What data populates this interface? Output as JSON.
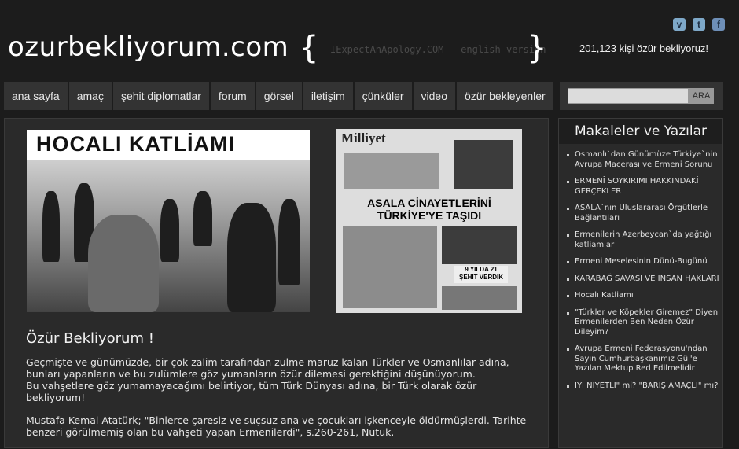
{
  "header": {
    "logo": "ozurbekliyorum.com",
    "brace_open": "{",
    "brace_close": "}",
    "tagline": "IExpectAnApology.COM - english version",
    "social": {
      "vimeo": "v",
      "twitter": "t",
      "facebook": "f"
    },
    "counter_number": "201,123",
    "counter_text": " kişi özür bekliyoruz!"
  },
  "nav": [
    "ana sayfa",
    "amaç",
    "şehit diplomatlar",
    "forum",
    "görsel",
    "iletişim",
    "çünküler",
    "video",
    "özür bekleyenler"
  ],
  "search": {
    "placeholder": "",
    "button": "ARA"
  },
  "main": {
    "photo1_title": "HOCALI KATLİAMI",
    "photo2_masthead": "Milliyet",
    "photo2_headline1": "ASALA CİNAYETLERİNİ",
    "photo2_headline2": "TÜRKİYE'YE TAŞIDI",
    "photo2_box1": "9 YILDA 21",
    "photo2_box2": "ŞEHİT VERDİK",
    "article_title": "Özür Bekliyorum !",
    "paragraph1": "Geçmişte ve günümüzde, bir çok zalim tarafından zulme maruz kalan Türkler ve Osmanlılar adına, bunları yapanların ve bu zulümlere göz yumanların özür dilemesi gerektiğini düşünüyorum.",
    "paragraph1b": "Bu vahşetlere göz yumamayacağımı belirtiyor, tüm Türk Dünyası adına, bir Türk olarak özür bekliyorum!",
    "paragraph2": "Mustafa Kemal Atatürk; \"Binlerce çaresiz ve suçsuz ana ve çocukları işkenceyle öldürmüşlerdi. Tarihte benzeri görülmemiş olan bu vahşeti yapan Ermenilerdi\", s.260-261, Nutuk."
  },
  "sidebar": {
    "title": "Makaleler ve Yazılar",
    "items": [
      "Osmanlı`dan Günümüze Türkiye`nin Avrupa Macerası ve Ermeni Sorunu",
      "ERMENİ SOYKIRIMI HAKKINDAKİ GERÇEKLER",
      "ASALA`nın Uluslararası Örgütlerle Bağlantıları",
      "Ermenilerin Azerbeycan`da yağtığı katliamlar",
      "Ermeni Meselesinin Dünü-Bugünü",
      "KARABAĞ SAVAŞI VE İNSAN HAKLARI",
      "Hocalı Katliamı",
      "\"Türkler ve Köpekler Giremez\" Diyen Ermenilerden Ben Neden Özür Dileyim?",
      "Avrupa Ermeni Federasyonu'ndan Sayın Cumhurbaşkanımız Gül'e Yazılan Mektup Red Edilmelidir",
      "İYİ NİYETLİ\" mi? \"BARIŞ AMAÇLI\" mı?"
    ]
  }
}
